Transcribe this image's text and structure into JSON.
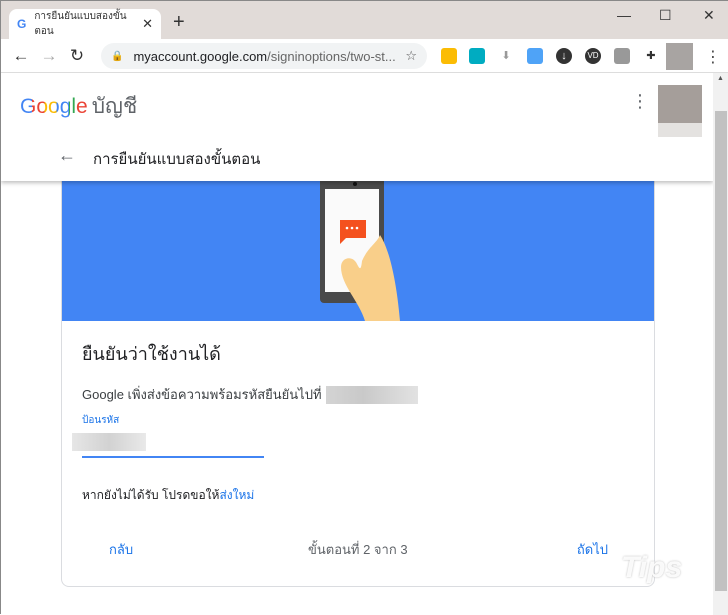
{
  "browser": {
    "tab_title": "การยืนยันแบบสองขั้นตอน",
    "url_host": "myaccount.google.com",
    "url_path": "/signinoptions/two-st..."
  },
  "header": {
    "logo": "Google",
    "account_label": "บัญชี",
    "page_title": "การยืนยันแบบสองขั้นตอน"
  },
  "card": {
    "title": "ยืนยันว่าใช้งานได้",
    "description": "Google เพิ่งส่งข้อความพร้อมรหัสยืนยันไปที่",
    "field_label": "ป้อนรหัส",
    "resend_prefix": "หากยังไม่ได้รับ โปรดขอให้",
    "resend_link": "ส่งใหม่",
    "back_label": "กลับ",
    "step_text": "ขั้นตอนที่ 2 จาก 3",
    "next_label": "ถัดไป"
  },
  "watermark": "Tips",
  "colors": {
    "banner": "#4285f4",
    "accent": "#1a73e8",
    "bubble": "#f4511e"
  }
}
